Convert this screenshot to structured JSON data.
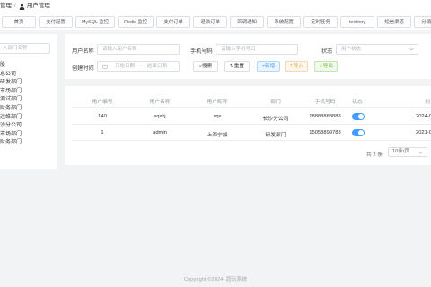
{
  "breadcrumb": {
    "parent": "管理",
    "separator": "/",
    "current": "用户管理"
  },
  "tabs": [
    "首页",
    "支付配置",
    "MySQL 监控",
    "Redis 监控",
    "支付订单",
    "退款订单",
    "回调通知",
    "系统配置",
    "定时任务",
    "territory",
    "短信渠道",
    "分销用户"
  ],
  "sidebar": {
    "search_placeholder": "入部门名称",
    "tree": [
      "股",
      "总公司",
      "研发部门",
      "市场部门",
      "测试部门",
      "财务部门",
      "运维部门",
      "沙分公司",
      "市场部门",
      "财务部门"
    ]
  },
  "search_form": {
    "username_label": "用户名称",
    "username_placeholder": "请输入用户名称",
    "mobile_label": "手机号码",
    "mobile_placeholder": "请输入手机号码",
    "status_label": "状态",
    "status_placeholder": "用户状态",
    "created_label": "创建时间",
    "start_placeholder": "开始日期",
    "range_sep": "-",
    "end_placeholder": "结束日期",
    "search_btn": "搜索",
    "reset_btn": "重置"
  },
  "toolbar": {
    "add": "+新增",
    "import": "导入",
    "export": "导出"
  },
  "table": {
    "columns": [
      "用户编号",
      "用户名称",
      "用户昵称",
      "部门",
      "手机号码",
      "状态",
      "创"
    ],
    "rows": [
      {
        "id": "140",
        "username": "sqxkj",
        "nickname": "sqx",
        "dept": "长沙分公司",
        "mobile": "18888888888",
        "status_on": true,
        "created": "2024-0"
      },
      {
        "id": "1",
        "username": "admin",
        "nickname": "上海宁加",
        "dept": "研发部门",
        "mobile": "15058899783",
        "status_on": true,
        "created": "2021-0"
      }
    ]
  },
  "pagination": {
    "total": "共 2 条",
    "page_size": "10条/页"
  },
  "footer": {
    "text": "Copyright ©2024- 超玩系统"
  },
  "colors": {
    "primary": "#409eff",
    "warning": "#e6a23c",
    "success": "#67c23a"
  }
}
